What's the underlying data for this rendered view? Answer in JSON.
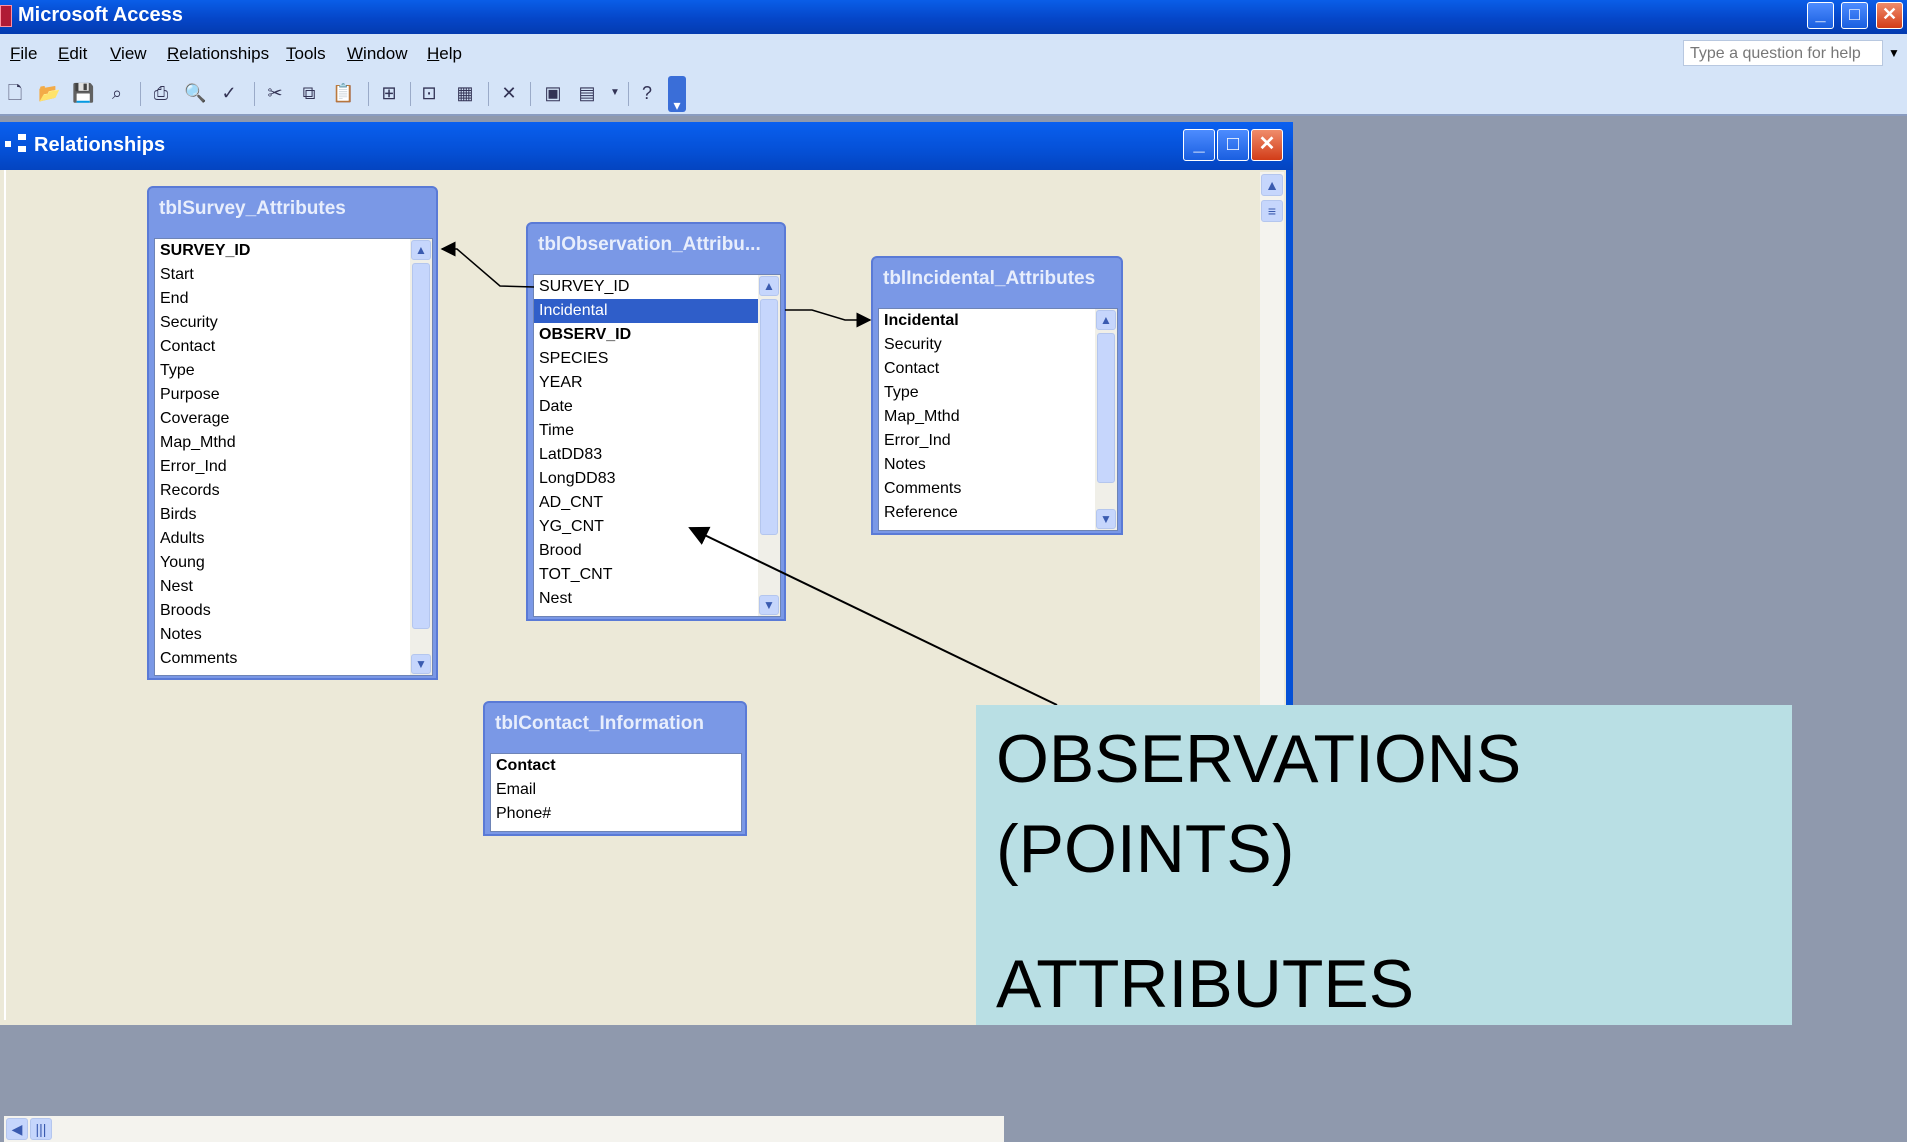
{
  "app": {
    "title": "Microsoft Access"
  },
  "menu": {
    "items": [
      {
        "key": "F",
        "rest": "ile"
      },
      {
        "key": "E",
        "rest": "dit"
      },
      {
        "key": "V",
        "rest": "iew"
      },
      {
        "key": "R",
        "rest": "elationships"
      },
      {
        "key": "T",
        "rest": "ools"
      },
      {
        "key": "W",
        "rest": "indow"
      },
      {
        "key": "H",
        "rest": "elp"
      }
    ],
    "help_placeholder": "Type a question for help"
  },
  "window": {
    "title": "Relationships"
  },
  "tables": [
    {
      "name": "tblSurvey_Attributes",
      "fields": [
        "SURVEY_ID",
        "Start",
        "End",
        "Security",
        "Contact",
        "Type",
        "Purpose",
        "Coverage",
        "Map_Mthd",
        "Error_Ind",
        "Records",
        "Birds",
        "Adults",
        "Young",
        "Nest",
        "Broods",
        "Notes",
        "Comments"
      ],
      "primary_key": "SURVEY_ID"
    },
    {
      "name": "tblObservation_Attribu...",
      "fields": [
        "SURVEY_ID",
        "Incidental",
        "OBSERV_ID",
        "SPECIES",
        "YEAR",
        "Date",
        "Time",
        "LatDD83",
        "LongDD83",
        "AD_CNT",
        "YG_CNT",
        "Brood",
        "TOT_CNT",
        "Nest"
      ],
      "primary_key": "OBSERV_ID",
      "selected": "Incidental"
    },
    {
      "name": "tblIncidental_Attributes",
      "fields": [
        "Incidental",
        "Security",
        "Contact",
        "Type",
        "Map_Mthd",
        "Error_Ind",
        "Notes",
        "Comments",
        "Reference"
      ],
      "primary_key": "Incidental"
    },
    {
      "name": "tblContact_Information",
      "fields": [
        "Contact",
        "Email",
        "Phone#"
      ],
      "primary_key": "Contact"
    }
  ],
  "callout": {
    "line1": "OBSERVATIONS",
    "line2": "(POINTS)",
    "line3": "ATTRIBUTES"
  },
  "colors": {
    "title_bar": "#0550d6",
    "canvas": "#ece9d8",
    "field_list_header": "#7a98e6",
    "callout_bg": "#b9dfe4"
  }
}
